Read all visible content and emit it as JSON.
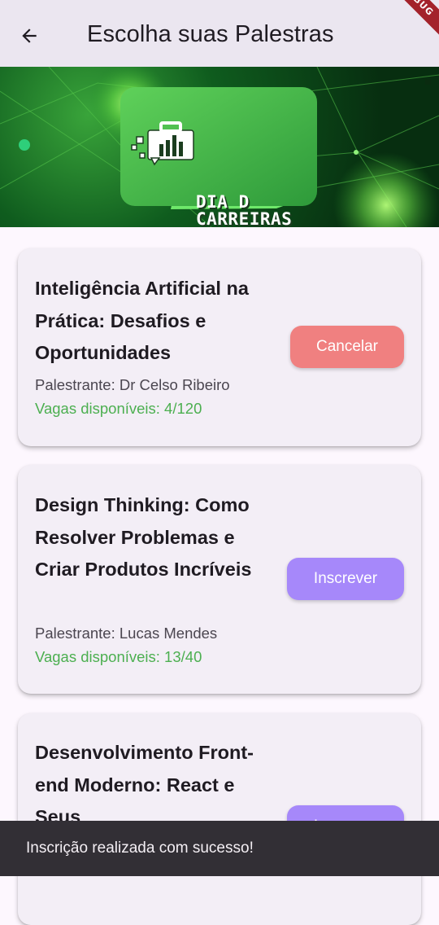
{
  "appbar": {
    "title": "Escolha suas Palestras",
    "debug_label": "DEBUG"
  },
  "banner": {
    "logo_line1": "DIA D",
    "logo_line2": "CARREIRAS"
  },
  "talks": [
    {
      "title": "Inteligência Artificial na Prática: Desafios e Oportunidades",
      "speaker": "Palestrante: Dr Celso Ribeiro",
      "vagas": "Vagas disponíveis: 4/120",
      "button": "Cancelar"
    },
    {
      "title": "Design Thinking: Como Resolver Problemas e Criar Produtos Incríveis",
      "speaker": "Palestrante: Lucas Mendes",
      "vagas": "Vagas disponíveis: 13/40",
      "button": "Inscrever"
    },
    {
      "title": "Desenvolvimento Front-end Moderno: React e Seus",
      "button": "Inscrever"
    }
  ],
  "snackbar": {
    "message": "Inscrição realizada com sucesso!"
  },
  "colors": {
    "cancel": "#f08080",
    "subscribe": "#a688fa",
    "vagas": "#4caf50"
  }
}
